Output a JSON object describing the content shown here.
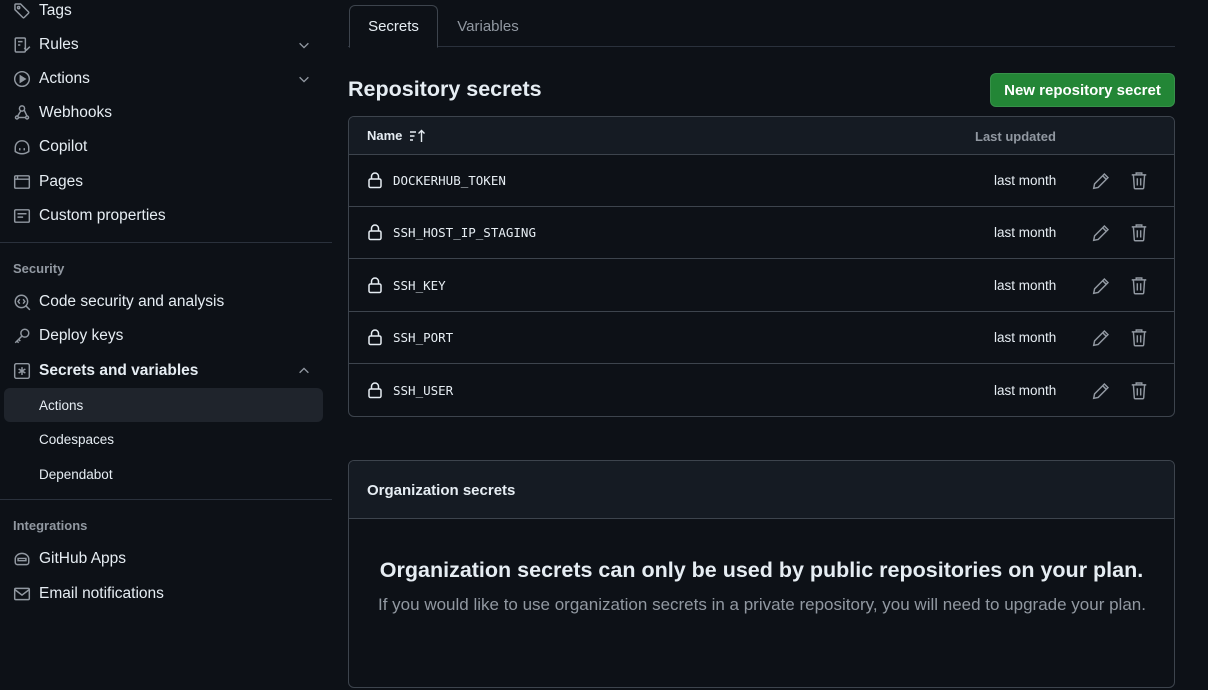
{
  "sidebar": {
    "items": [
      {
        "label": "Tags",
        "icon": "tag-icon"
      },
      {
        "label": "Rules",
        "icon": "rules-icon"
      },
      {
        "label": "Actions",
        "icon": "play-icon"
      },
      {
        "label": "Webhooks",
        "icon": "webhook-icon"
      },
      {
        "label": "Copilot",
        "icon": "copilot-icon"
      },
      {
        "label": "Pages",
        "icon": "browser-icon"
      },
      {
        "label": "Custom properties",
        "icon": "note-icon"
      }
    ],
    "security_label": "Security",
    "security_items": [
      {
        "label": "Code security and analysis",
        "icon": "codescan-icon"
      },
      {
        "label": "Deploy keys",
        "icon": "key-icon"
      },
      {
        "label": "Secrets and variables",
        "icon": "asterisk-icon"
      }
    ],
    "sub_items": [
      {
        "label": "Actions"
      },
      {
        "label": "Codespaces"
      },
      {
        "label": "Dependabot"
      }
    ],
    "integrations_label": "Integrations",
    "integration_items": [
      {
        "label": "GitHub Apps",
        "icon": "hubot-icon"
      },
      {
        "label": "Email notifications",
        "icon": "mail-icon"
      }
    ]
  },
  "tabs": [
    {
      "label": "Secrets"
    },
    {
      "label": "Variables"
    }
  ],
  "page_title": "Repository secrets",
  "new_secret_button": "New repository secret",
  "table": {
    "col_name": "Name",
    "col_updated": "Last updated",
    "rows": [
      {
        "name": "DOCKERHUB_TOKEN",
        "updated": "last month"
      },
      {
        "name": "SSH_HOST_IP_STAGING",
        "updated": "last month"
      },
      {
        "name": "SSH_KEY",
        "updated": "last month"
      },
      {
        "name": "SSH_PORT",
        "updated": "last month"
      },
      {
        "name": "SSH_USER",
        "updated": "last month"
      }
    ]
  },
  "org": {
    "title": "Organization secrets",
    "blank_title": "Organization secrets can only be used by public repositories on your plan.",
    "blank_desc": "If you would like to use organization secrets in a private repository, you will need to upgrade your plan."
  },
  "colors": {
    "background": "#0d1117",
    "primary_button": "#238636",
    "border": "#3d444d",
    "muted_text": "#9198a1"
  }
}
